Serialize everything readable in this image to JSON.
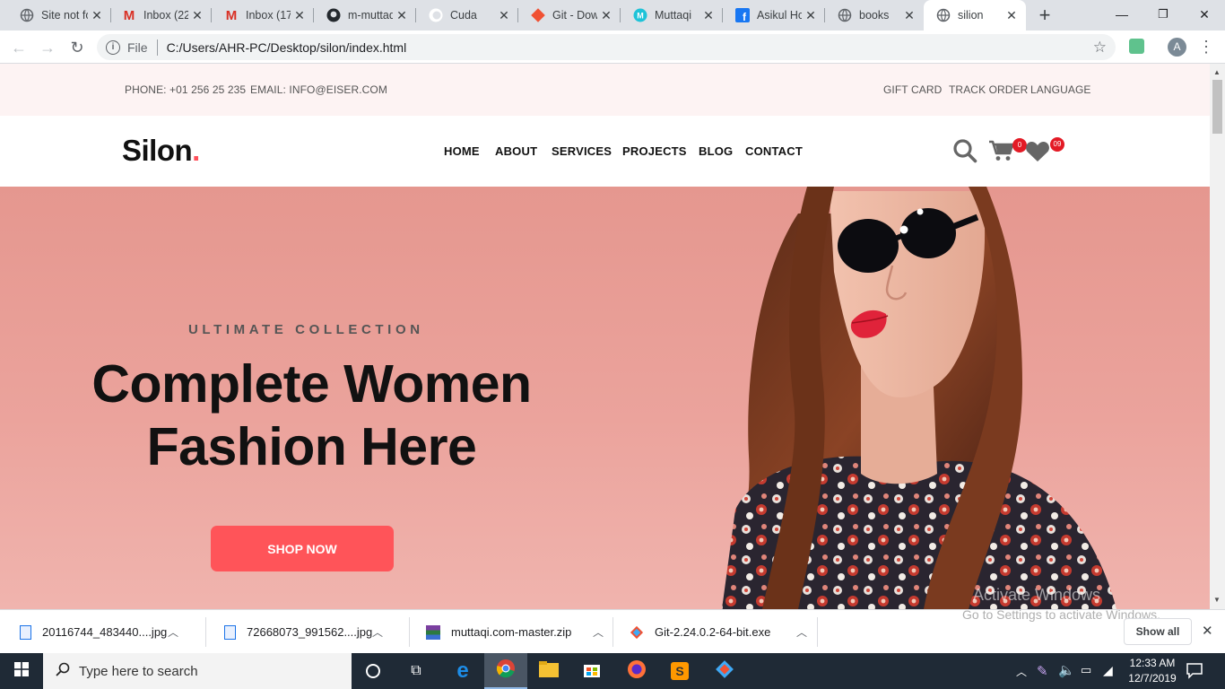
{
  "browser": {
    "tabs": [
      {
        "title": "Site not fo",
        "icon": "globe-icon"
      },
      {
        "title": "Inbox (22",
        "icon": "gmail-icon"
      },
      {
        "title": "Inbox (17",
        "icon": "gmail-icon"
      },
      {
        "title": "m-muttaq",
        "icon": "github-icon"
      },
      {
        "title": "Cuda",
        "icon": "cuda-icon"
      },
      {
        "title": "Git - Dow",
        "icon": "git-icon"
      },
      {
        "title": "Muttaqi",
        "icon": "m-logo-icon"
      },
      {
        "title": "Asikul Ho",
        "icon": "facebook-icon"
      },
      {
        "title": "books",
        "icon": "globe-icon"
      },
      {
        "title": "silion",
        "icon": "globe-icon",
        "active": true
      }
    ],
    "new_tab": "+",
    "address": {
      "scheme_label": "File",
      "url": "C:/Users/AHR-PC/Desktop/silon/index.html"
    },
    "profile_initial": "A"
  },
  "page": {
    "topbar": {
      "phone": "PHONE: +01 256 25 235",
      "email": "EMAIL: INFO@EISER.COM",
      "links": [
        "GIFT CARD",
        "TRACK ORDER",
        "LANGUAGE"
      ]
    },
    "logo": {
      "text": "Silon",
      "dot": "."
    },
    "nav": [
      "HOME",
      "ABOUT",
      "SERVICES",
      "PROJECTS",
      "BLOG",
      "CONTACT"
    ],
    "cart_count": "0",
    "wishlist_count": "09",
    "hero": {
      "eyebrow": "ULTIMATE COLLECTION",
      "headline_line1": "Complete Women",
      "headline_line2": "Fashion Here",
      "cta": "SHOP NOW"
    },
    "watermark": {
      "line1": "Activate Windows",
      "line2": "Go to Settings to activate Windows."
    }
  },
  "downloads": {
    "items": [
      "20116744_483440....jpg",
      "72668073_991562....jpg",
      "muttaqi.com-master.zip",
      "Git-2.24.0.2-64-bit.exe"
    ],
    "show_all": "Show all"
  },
  "taskbar": {
    "search_placeholder": "Type here to search",
    "time": "12:33 AM",
    "date": "12/7/2019"
  },
  "colors": {
    "accent": "#ff5459",
    "hero_bg": "#eba39c",
    "topbar_bg": "#fdf3f3",
    "taskbar_bg": "#1f2a36"
  }
}
